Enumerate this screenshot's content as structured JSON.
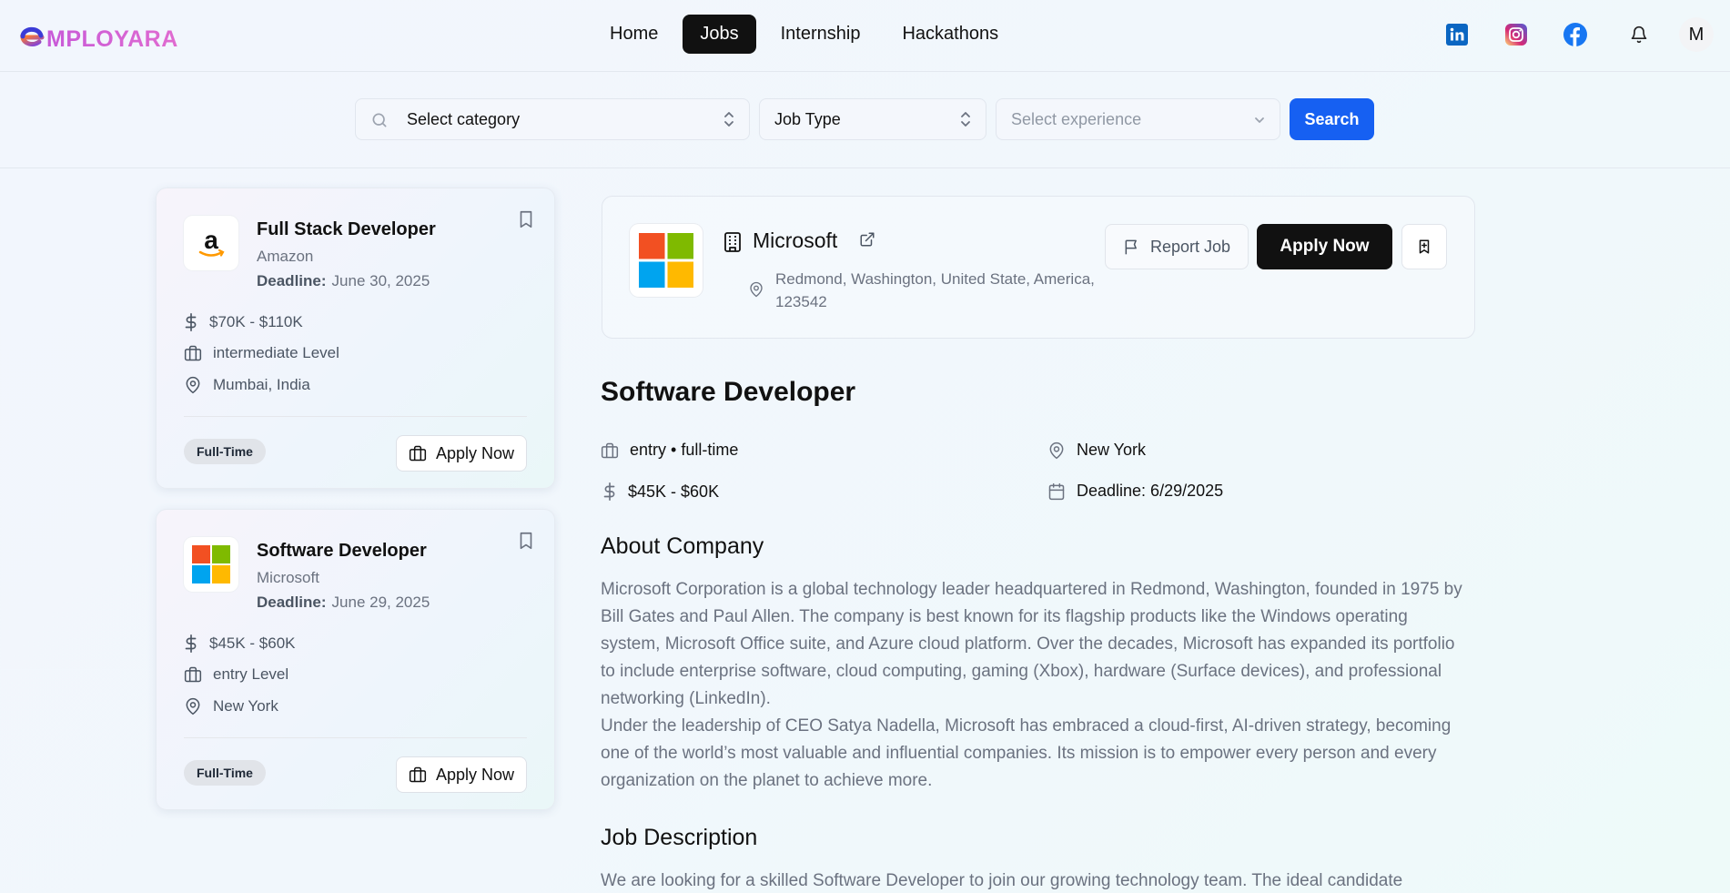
{
  "brand": {
    "name": "MPLOYARA"
  },
  "nav": {
    "items": [
      "Home",
      "Jobs",
      "Internship",
      "Hackathons"
    ],
    "active": "Jobs"
  },
  "header": {
    "avatar_initial": "M"
  },
  "search": {
    "category_label": "Select category",
    "job_type_label": "Job Type",
    "experience_placeholder": "Select experience",
    "button": "Search"
  },
  "cards": [
    {
      "title": "Full Stack Developer",
      "company": "Amazon",
      "deadline_label": "Deadline:",
      "deadline": "June 30, 2025",
      "salary": "$70K - $110K",
      "level": "intermediate Level",
      "location": "Mumbai, India",
      "type": "Full-Time",
      "apply": "Apply Now"
    },
    {
      "title": "Software Developer",
      "company": "Microsoft",
      "deadline_label": "Deadline:",
      "deadline": "June 29, 2025",
      "salary": "$45K - $60K",
      "level": "entry Level",
      "location": "New York",
      "type": "Full-Time",
      "apply": "Apply Now"
    }
  ],
  "detail": {
    "company": "Microsoft",
    "address": "Redmond, Washington, United State, America, 123542",
    "report": "Report Job",
    "apply": "Apply Now",
    "job_title": "Software Developer",
    "experience_type": "entry • full-time",
    "location": "New York",
    "salary": "$45K - $60K",
    "deadline": "Deadline: 6/29/2025",
    "about_heading": "About Company",
    "about_p1": "Microsoft Corporation is a global technology leader headquartered in Redmond, Washington, founded in 1975 by Bill Gates and Paul Allen. The company is best known for its flagship products like the Windows operating system, Microsoft Office suite, and Azure cloud platform. Over the decades, Microsoft has expanded its portfolio to include enterprise software, cloud computing, gaming (Xbox), hardware (Surface devices), and professional networking (LinkedIn).",
    "about_p2": "Under the leadership of CEO Satya Nadella, Microsoft has embraced a cloud-first, AI-driven strategy, becoming one of the world’s most valuable and influential companies. Its mission is to empower every person and every organization on the planet to achieve more.",
    "desc_heading": "Job Description",
    "desc_p1": "We are looking for a skilled Software Developer to join our growing technology team. The ideal candidate"
  },
  "colors": {
    "accent": "#1660f2",
    "brand": "#d062d6",
    "dark": "#111111"
  }
}
